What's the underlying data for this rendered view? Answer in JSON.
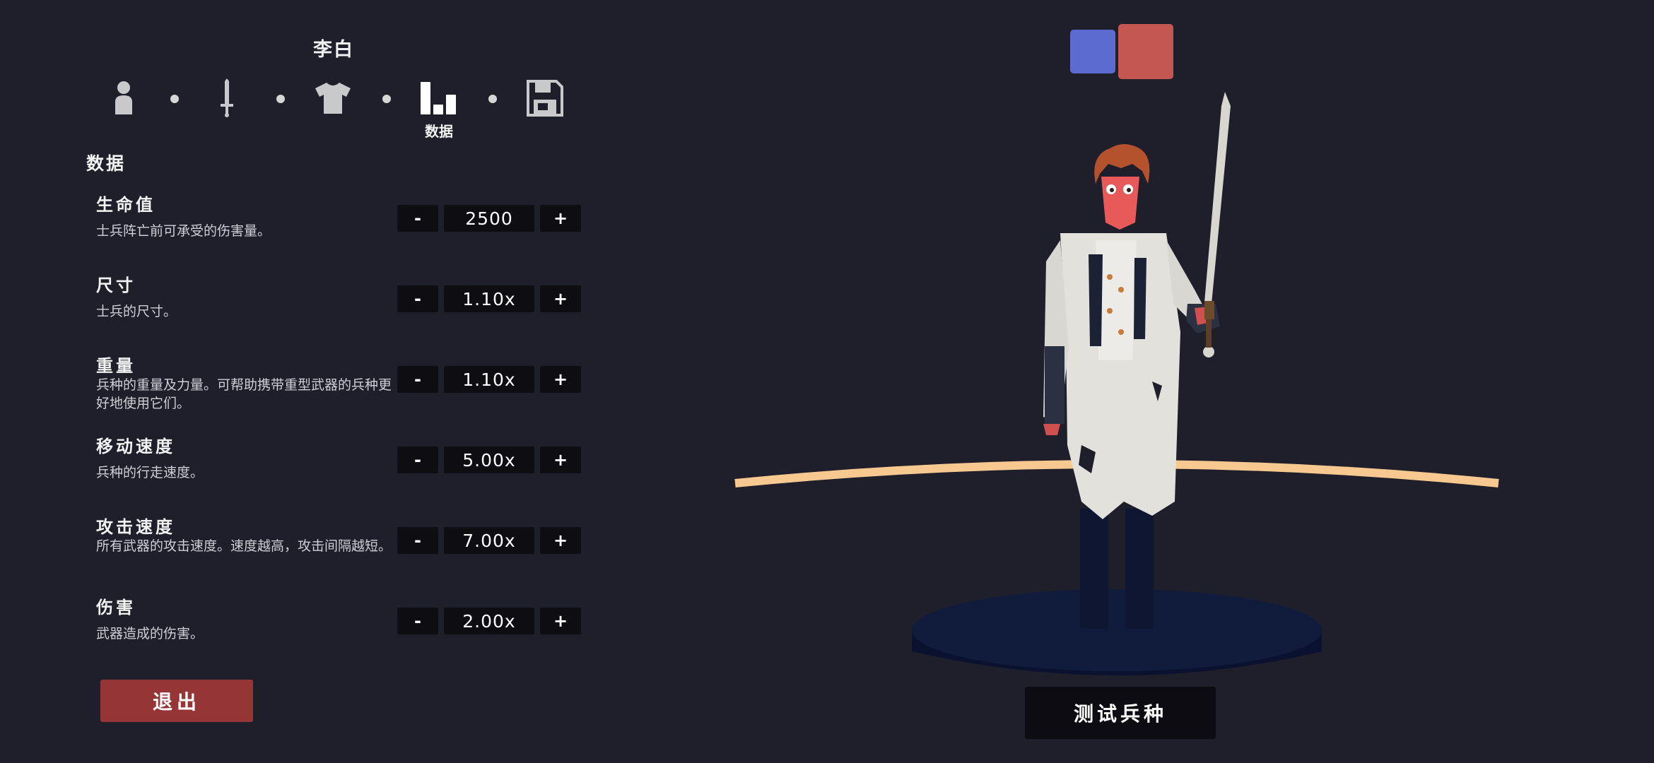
{
  "unit": {
    "name": "李白"
  },
  "steps": [
    {
      "key": "body",
      "icon": "person-icon"
    },
    {
      "key": "weapon",
      "icon": "sword-icon"
    },
    {
      "key": "clothing",
      "icon": "shirt-icon"
    },
    {
      "key": "stats",
      "icon": "bar-chart-icon",
      "label": "数据",
      "active": true
    },
    {
      "key": "save",
      "icon": "floppy-disk-icon"
    }
  ],
  "section": {
    "title": "数据"
  },
  "stats": [
    {
      "name": "生命值",
      "desc": "士兵阵亡前可承受的伤害量。",
      "value": "2500"
    },
    {
      "name": "尺寸",
      "desc": "士兵的尺寸。",
      "value": "1.10x"
    },
    {
      "name": "重量",
      "desc": "兵种的重量及力量。可帮助携带重型武器的兵种更好地使用它们。",
      "value": "1.10x"
    },
    {
      "name": "移动速度",
      "desc": "兵种的行走速度。",
      "value": "5.00x"
    },
    {
      "name": "攻击速度",
      "desc": "所有武器的攻击速度。速度越高，攻击间隔越短。",
      "value": "7.00x"
    },
    {
      "name": "伤害",
      "desc": "武器造成的伤害。",
      "value": "2.00x"
    }
  ],
  "controls": {
    "minus": "-",
    "plus": "+"
  },
  "buttons": {
    "exit": "退出",
    "test": "测试兵种"
  },
  "teams": {
    "blue": "#5b6bd0",
    "red": "#c55753"
  },
  "colors": {
    "background": "#1f1e2b",
    "exit": "#963535",
    "ring": "#f7c88f",
    "pedestal": "#0f1a38"
  }
}
